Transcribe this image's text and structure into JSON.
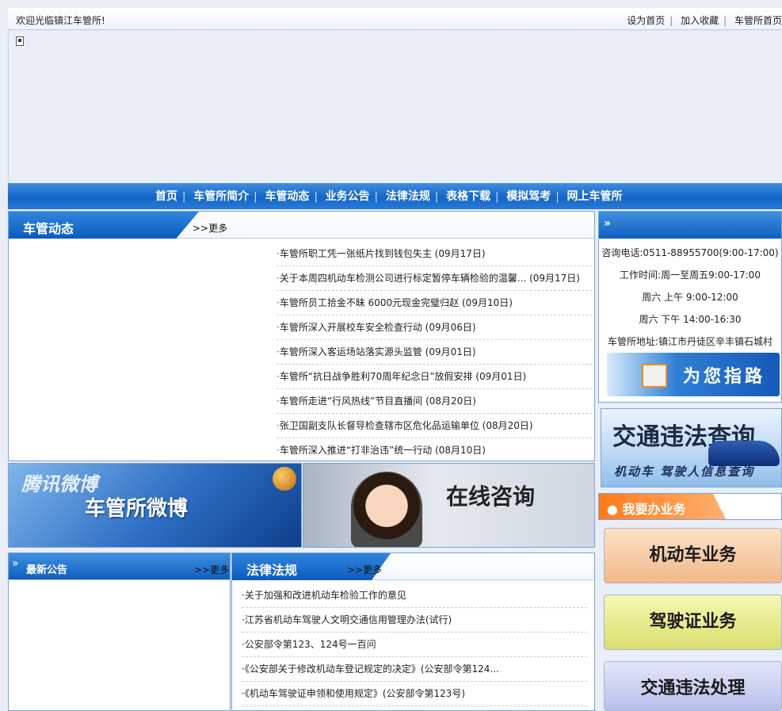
{
  "topbar": {
    "welcome": "欢迎光临镇江车管所!",
    "links": [
      "设为首页",
      "加入收藏",
      "车管所首页"
    ]
  },
  "nav": {
    "items": [
      "首页",
      "车管所简介",
      "车管动态",
      "业务公告",
      "法律法规",
      "表格下载",
      "模拟驾考",
      "网上车管所"
    ]
  },
  "news": {
    "title": "车管动态",
    "more": ">>更多",
    "items": [
      "车管所职工凭一张纸片找到钱包失主 (09月17日)",
      "关于本周四机动车检测公司进行标定暂停车辆检验的温馨... (09月17日)",
      "车管所员工拾金不昧 6000元现金完璧归赵 (09月10日)",
      "车管所深入开展校车安全检查行动 (09月06日)",
      "车管所深入客运场站落实源头监管 (09月01日)",
      "车管所“抗日战争胜利70周年纪念日”放假安排 (09月01日)",
      "车管所走进“行风热线”节目直播间 (08月20日)",
      "张卫国副支队长督导检查辖市区危化品运输单位 (08月20日)",
      "车管所深入推进“打非治违”统一行动 (08月10日)"
    ]
  },
  "contact": {
    "lines": [
      "咨询电话:0511-88955700(9:00-17:00)",
      "工作时间:周一至周五9:00-17:00",
      "周六 上午 9:00-12:00",
      "周六 下午 14:00-16:30",
      "车管所地址:镇江市丹徒区辛丰镇石城村"
    ],
    "guide_banner": "为您指路"
  },
  "violation_query": {
    "title": "交通违法查询",
    "subtitle": "机动车 驾驶人信息查询"
  },
  "weibo": {
    "logo": "腾讯微博",
    "title": "车管所微博"
  },
  "consult": {
    "title": "在线咨询"
  },
  "notice": {
    "title": "最新公告",
    "more": ">>更多"
  },
  "law": {
    "title": "法律法规",
    "more": ">>更多",
    "items": [
      "关于加强和改进机动车检验工作的意见",
      "江苏省机动车驾驶人文明交通信用管理办法(试行)",
      "公安部令第123、124号一百问",
      "《公安部关于修改机动车登记规定的决定》(公安部令第124...",
      "《机动车驾驶证申领和使用规定》(公安部令第123号)"
    ]
  },
  "business": {
    "title": "我要办业务",
    "buttons": [
      "机动车业务",
      "驾驶证业务",
      "交通违法处理"
    ]
  },
  "colors": {
    "nav_blue": "#1565c6",
    "accent_orange": "#ff7a1a"
  }
}
